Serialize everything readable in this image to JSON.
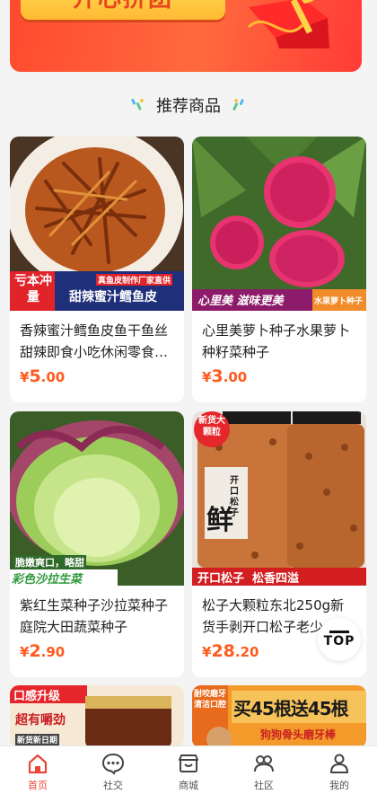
{
  "banner": {
    "text": "开心拼团"
  },
  "section": {
    "title": "推荐商品"
  },
  "products": [
    {
      "name": "香辣蜜汁鳕鱼皮鱼干鱼丝甜辣即食小吃休闲零食…",
      "currency": "¥",
      "price_int": "5",
      "price_dec": ".00",
      "badge": "亏本冲量",
      "tag": "真鱼皮制作厂家直供",
      "caption": "甜辣蜜汁鳕鱼皮"
    },
    {
      "name": "心里美萝卜种子水果萝卜种籽菜种子",
      "currency": "¥",
      "price_int": "3",
      "price_dec": ".00",
      "caption": "心里美 滋味更美",
      "tag": "水果萝卜种子"
    },
    {
      "name": "紫红生菜种子沙拉菜种子庭院大田蔬菜种子",
      "currency": "¥",
      "price_int": "2",
      "price_dec": ".90",
      "tag": "脆嫩爽口，略甜",
      "caption": "彩色沙拉生菜"
    },
    {
      "name": "松子大颗粒东北250g新货手剥开口松子老少",
      "currency": "¥",
      "price_int": "28",
      "price_dec": ".20",
      "badge": "新货大颗粒",
      "label": "开口松子",
      "fresh": "鲜",
      "caption": "开口松子  松香四溢"
    },
    {
      "badge": "口感升级",
      "tag": "超有嚼劲",
      "date": "新货新日期"
    },
    {
      "badge": "耐咬磨牙清洁口腔",
      "caption": "买45根送45根",
      "tag": "狗狗骨头磨牙棒"
    }
  ],
  "top_button": {
    "label": "TOP"
  },
  "tabbar": {
    "items": [
      {
        "label": "首页",
        "icon": "home-icon",
        "active": true
      },
      {
        "label": "社交",
        "icon": "chat-bubble-icon"
      },
      {
        "label": "商城",
        "icon": "store-icon"
      },
      {
        "label": "社区",
        "icon": "community-icon"
      },
      {
        "label": "我的",
        "icon": "person-icon"
      }
    ]
  },
  "colors": {
    "accent": "#ff5a1f",
    "tab_active": "#e9453a",
    "banner": "#ff4a2f"
  }
}
